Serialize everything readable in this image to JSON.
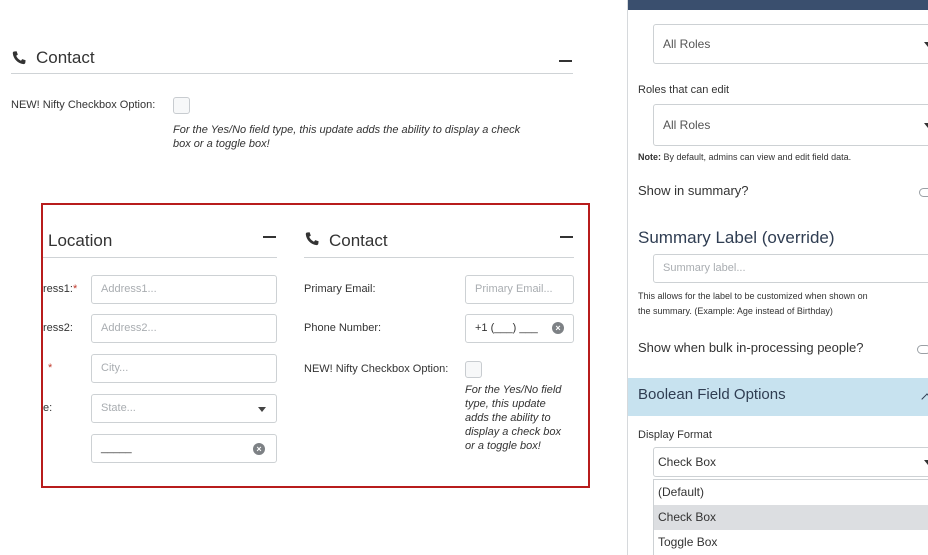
{
  "top_contact": {
    "title": "Contact",
    "checkbox_label": "NEW! Nifty Checkbox Option:",
    "help_text_line1": "For the Yes/No field type, this update adds the ability to display a check",
    "help_text_line2": "box or a toggle box!"
  },
  "location": {
    "title": "Location",
    "address1_label": "ress1:",
    "address1_required": "*",
    "address1_placeholder": "Address1...",
    "address2_label": "ress2:",
    "address2_placeholder": "Address2...",
    "city_required": "*",
    "city_placeholder": "City...",
    "state_label": "e:",
    "state_placeholder": "State...",
    "zip_value": "_____"
  },
  "contact": {
    "title": "Contact",
    "email_label": "Primary Email:",
    "email_placeholder": "Primary Email...",
    "phone_label": "Phone Number:",
    "phone_value": "+1 (___) ___",
    "checkbox_label": "NEW! Nifty Checkbox Option:",
    "help_lines": [
      "For the Yes/No field",
      "type, this update",
      "adds the ability to",
      "display a check box",
      "or a toggle box!"
    ]
  },
  "panel": {
    "view_roles_value": "All Roles",
    "edit_roles_label": "Roles that can edit",
    "edit_roles_value": "All Roles",
    "note_bold": "Note:",
    "note_text": " By default, admins can view and edit field data.",
    "show_in_summary_label": "Show in summary?",
    "summary_label_heading": "Summary Label (override)",
    "summary_label_placeholder": "Summary label...",
    "summary_help_line1": "This allows for the label to be customized when shown on",
    "summary_help_line2": "the summary. (Example: Age instead of Birthday)",
    "bulk_label": "Show when bulk in-processing people?",
    "boolean_heading": "Boolean Field Options",
    "display_format_label": "Display Format",
    "display_format_value": "Check Box",
    "display_format_options": [
      "(Default)",
      "Check Box",
      "Toggle Box"
    ],
    "display_format_selected_index": 1
  }
}
